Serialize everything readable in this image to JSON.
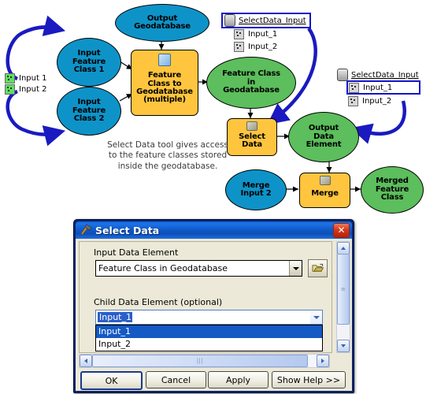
{
  "diagram": {
    "legend": [
      {
        "label": "Input 1",
        "icon": "feature-class-icon"
      },
      {
        "label": "Input 2",
        "icon": "feature-class-icon"
      }
    ],
    "nodes": {
      "input_fc_1": "Input\nFeature\nClass 1",
      "input_fc_2": "Input\nFeature\nClass 2",
      "output_gdb": "Output\nGeodatabase",
      "fc_to_gdb_tool": "Feature\nClass to\nGeodatabase\n(multiple)",
      "fc_in_gdb": "Feature Class\nin\nGeodatabase",
      "select_data_tool": "Select\nData",
      "output_data_element": "Output\nData\nElement",
      "merge_input_2": "Merge\nInput 2",
      "merge_tool": "Merge",
      "merged_fc": "Merged\nFeature\nClass"
    },
    "tree_top": {
      "root": "SelectData_Input",
      "children": [
        "Input_1",
        "Input_2"
      ],
      "selected": "SelectData_Input"
    },
    "tree_right": {
      "root": "SelectData_Input",
      "children": [
        "Input_1",
        "Input_2"
      ],
      "selected": "Input_1"
    },
    "caption": "Select Data tool gives access\nto the feature classes stored\ninside the geodatabase.",
    "colors": {
      "blue_ellipse": "#0e93c8",
      "green_ellipse": "#5cbe5c",
      "orange_tool": "#ffc53e",
      "arrow_blue": "#1a1ac0",
      "selection_blue": "#1414c8"
    }
  },
  "dialog": {
    "title": "Select Data",
    "title_icon": "hammer-icon",
    "close_label": "✕",
    "input_data_element": {
      "label": "Input Data Element",
      "value": "Feature Class in Geodatabase",
      "browse_icon": "open-folder-icon"
    },
    "child_data_element": {
      "label": "Child Data Element (optional)",
      "value": "Input_1",
      "options": [
        "Input_1",
        "Input_2"
      ],
      "selected": "Input_1",
      "expanded": true
    },
    "buttons": [
      {
        "name": "ok",
        "label": "OK",
        "default": true
      },
      {
        "name": "cancel",
        "label": "Cancel",
        "default": false
      },
      {
        "name": "apply",
        "label": "Apply",
        "default": false
      },
      {
        "name": "show-help",
        "label": "Show Help >>",
        "default": false
      }
    ],
    "scrollbars": {
      "vertical": true,
      "horizontal": true
    }
  }
}
